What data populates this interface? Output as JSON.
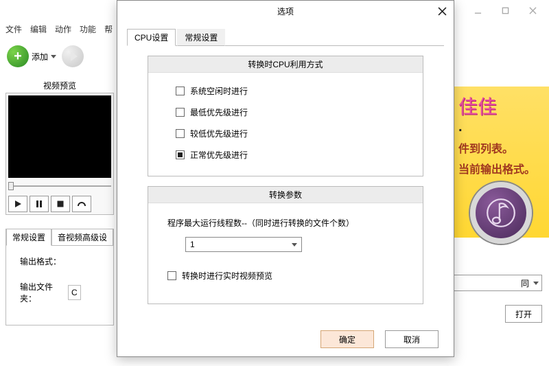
{
  "window": {
    "menu": [
      "文件",
      "编辑",
      "动作",
      "功能",
      "帮"
    ]
  },
  "toolbar": {
    "add_label": "添加"
  },
  "preview": {
    "title": "视频预览"
  },
  "settings_tabs": {
    "t1": "常规设置",
    "t2": "音视频高级设"
  },
  "form": {
    "output_format_label": "输出格式：",
    "output_folder_label": "输出文件夹：",
    "output_folder_value": "C"
  },
  "right": {
    "fancy": "佳佳",
    "line1": "件到列表。",
    "line2": "当前输出格式。",
    "combo_value": "同",
    "open_label": "打开"
  },
  "dialog": {
    "title": "选项",
    "tabs": {
      "cpu": "CPU设置",
      "general": "常规设置"
    },
    "group1_title": "转换时CPU利用方式",
    "opt1": "系统空闲时进行",
    "opt2": "最低优先级进行",
    "opt3": "较低优先级进行",
    "opt4": "正常优先级进行",
    "group2_title": "转换参数",
    "param_label": "程序最大运行线程数--（同时进行转换的文件个数）",
    "thread_value": "1",
    "preview_chk": "转换时进行实时视频预览",
    "ok": "确定",
    "cancel": "取消"
  }
}
